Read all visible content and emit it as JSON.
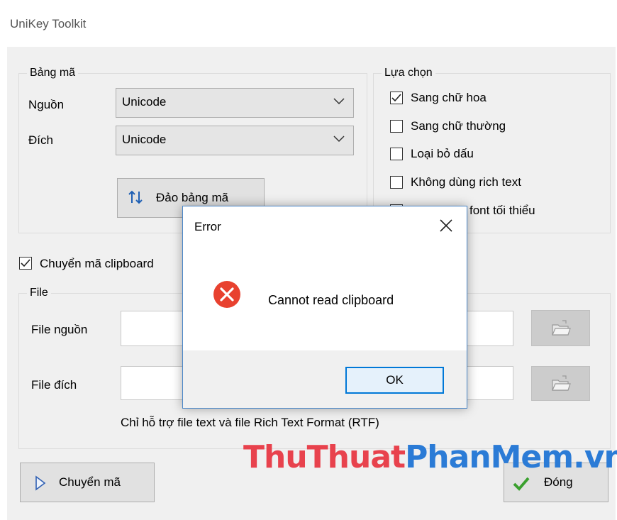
{
  "window": {
    "title": "UniKey Toolkit"
  },
  "bang_ma": {
    "legend": "Bảng mã",
    "source_label": "Nguồn",
    "source_value": "Unicode",
    "dest_label": "Đích",
    "dest_value": "Unicode",
    "swap_button": "Đảo bảng mã"
  },
  "lua_chon": {
    "legend": "Lựa chọn",
    "options": [
      {
        "label": "Sang chữ hoa",
        "checked": true
      },
      {
        "label": "Sang chữ thường",
        "checked": false
      },
      {
        "label": "Loại bỏ dấu",
        "checked": false
      },
      {
        "label": "Không dùng rich text",
        "checked": false
      },
      {
        "label": "font tối thiểu",
        "checked": false
      }
    ]
  },
  "clipboard": {
    "label": "Chuyển mã clipboard",
    "checked": true
  },
  "file": {
    "legend": "File",
    "source_label": "File nguồn",
    "dest_label": "File đích",
    "note": "Chỉ hỗ trợ file text và file Rich Text Format (RTF)"
  },
  "buttons": {
    "convert": "Chuyển mã",
    "close": "Đóng"
  },
  "dialog": {
    "title": "Error",
    "message": "Cannot read clipboard",
    "ok": "OK",
    "icon": "error-icon"
  },
  "watermark": {
    "part1": "ThuThuat",
    "part2": "PhanMem",
    "part3": ".vn"
  },
  "colors": {
    "accent": "#0078d7",
    "error_red": "#e8412f",
    "watermark_red": "#e8424d",
    "watermark_blue": "#2b7bd6"
  }
}
